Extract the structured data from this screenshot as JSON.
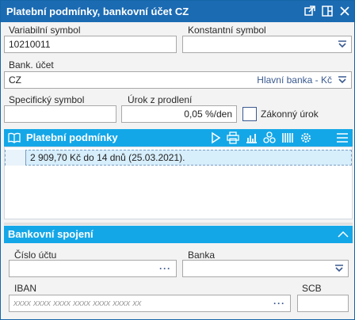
{
  "window": {
    "title": "Platební podmínky, bankovní účet CZ"
  },
  "fields": {
    "variabilni_symbol": {
      "label": "Variabilní symbol",
      "value": "10210011"
    },
    "konstantni_symbol": {
      "label": "Konstantní symbol",
      "value": ""
    },
    "bank_ucet": {
      "label": "Bank. účet",
      "value": "CZ",
      "bank_name": "Hlavní banka - Kč"
    },
    "specificky_symbol": {
      "label": "Specifický symbol",
      "value": ""
    },
    "urok_z_prodleni": {
      "label": "Úrok z prodlení",
      "value": "0,05 %/den"
    },
    "zakonny_urok": {
      "label": "Zákonný úrok",
      "checked": false
    }
  },
  "platebni_podminky": {
    "title": "Platební podmínky",
    "rows": [
      {
        "text": "2 909,70 Kč do 14 dnů (25.03.2021)."
      }
    ]
  },
  "bankovni_spojeni": {
    "title": "Bankovní spojení",
    "cislo_uctu": {
      "label": "Číslo účtu",
      "value": ""
    },
    "banka": {
      "label": "Banka",
      "value": ""
    },
    "iban": {
      "label": "IBAN",
      "placeholder": "xxxx xxxx xxxx xxxx xxxx xxxx xx"
    },
    "scb": {
      "label": "SCB",
      "value": ""
    }
  },
  "colors": {
    "titlebar": "#1b6bb3",
    "panel_header": "#14a7e8",
    "selected_row": "#d7eefb"
  },
  "icons": [
    "popout-icon",
    "dock-icon",
    "close-icon",
    "book-icon",
    "play-icon",
    "print-icon",
    "chart-icon",
    "group-icon",
    "columns-icon",
    "settings-icon",
    "menu-icon",
    "collapse-icon",
    "dropdown-icon",
    "ellipsis-icon"
  ]
}
